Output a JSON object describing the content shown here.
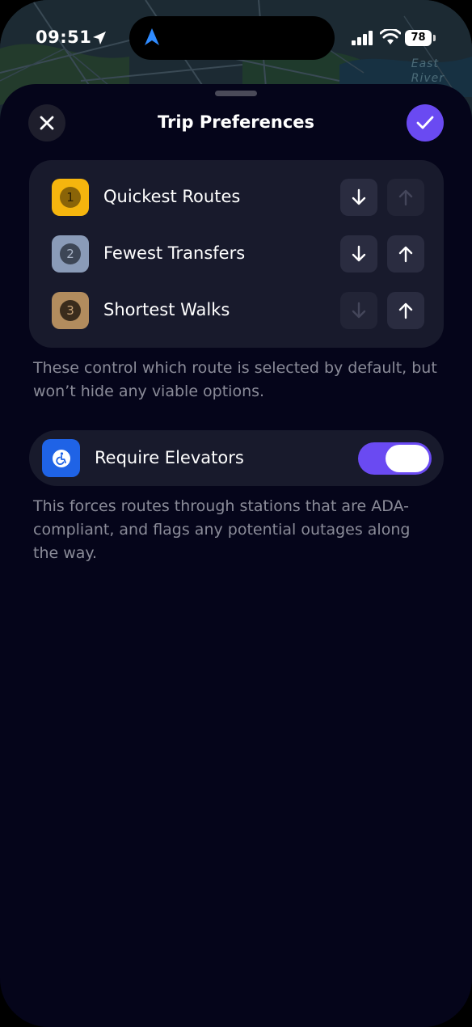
{
  "status_bar": {
    "time": "09:51",
    "battery": "78"
  },
  "map": {
    "label_line1": "East",
    "label_line2": "River"
  },
  "sheet": {
    "title": "Trip Preferences",
    "close_icon": "close-icon",
    "confirm_icon": "checkmark-icon"
  },
  "preferences": {
    "items": [
      {
        "rank": "1",
        "label": "Quickest Routes",
        "color": "#f5b50e",
        "num_color": "#4a3505",
        "num_bg": "#8a6408",
        "down_enabled": true,
        "up_enabled": false
      },
      {
        "rank": "2",
        "label": "Fewest Transfers",
        "color": "#8a9bb8",
        "num_color": "#b9c4d6",
        "num_bg": "#3d4656",
        "down_enabled": true,
        "up_enabled": true
      },
      {
        "rank": "3",
        "label": "Shortest Walks",
        "color": "#b28c5e",
        "num_color": "#c9a478",
        "num_bg": "#4b3824",
        "down_enabled": false,
        "up_enabled": true
      }
    ],
    "note": "These control which route is selected by default, but won’t hide any viable options."
  },
  "elevators": {
    "label": "Require Elevators",
    "enabled": true,
    "icon": "wheelchair-icon",
    "note": "This forces routes through stations that are ADA-compliant, and flags any potential outages along the way."
  },
  "colors": {
    "accent": "#6a4af2",
    "sheet_bg": "#05051a",
    "card_bg": "#181a2c",
    "elevator_icon_bg": "#1f63e6"
  }
}
